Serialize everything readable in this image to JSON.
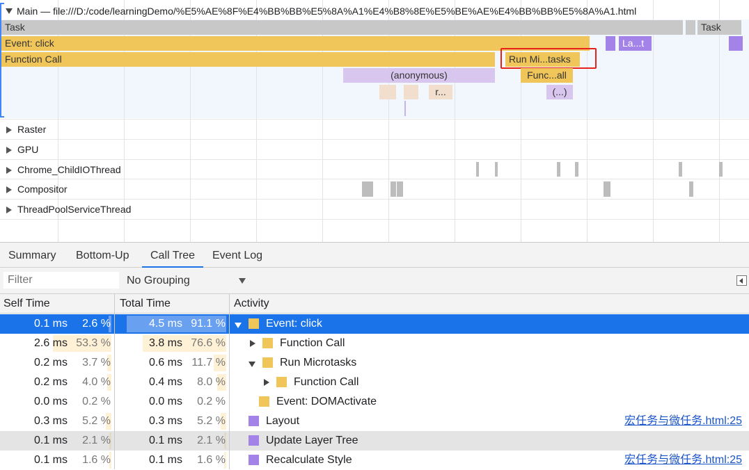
{
  "timeline": {
    "main_title": "Main — file:///D:/code/learningDemo/%E5%AE%8F%E4%BB%BB%E5%8A%A1%E4%B8%8E%E5%BE%AE%E4%BB%BB%E5%8A%A1.html",
    "bars": {
      "task1": "Task",
      "task2": "Task",
      "event_click": "Event: click",
      "layout_short": "La...t",
      "function_call": "Function Call",
      "run_microtasks": "Run Mi...tasks",
      "anonymous": "(anonymous)",
      "func_call_short": "Func...all",
      "r_short": "r...",
      "ellipsis": "(...)"
    },
    "tracks": [
      "Raster",
      "GPU",
      "Chrome_ChildIOThread",
      "Compositor",
      "ThreadPoolServiceThread"
    ]
  },
  "tabs": [
    {
      "label": "Summary",
      "active": false
    },
    {
      "label": "Bottom-Up",
      "active": false
    },
    {
      "label": "Call Tree",
      "active": true
    },
    {
      "label": "Event Log",
      "active": false
    }
  ],
  "filter": {
    "placeholder": "Filter",
    "grouping": "No Grouping"
  },
  "columns": {
    "self_time": "Self Time",
    "total_time": "Total Time",
    "activity": "Activity"
  },
  "rows": [
    {
      "self": "0.1 ms",
      "self_pct": "2.6 %",
      "total": "4.5 ms",
      "total_pct": "91.1 %",
      "activity": "Event: click",
      "link": "",
      "color": "#f0c65a",
      "expander": "down",
      "selected": true
    },
    {
      "self": "2.6 ms",
      "self_pct": "53.3 %",
      "total": "3.8 ms",
      "total_pct": "76.6 %",
      "activity": "Function Call",
      "link": "",
      "color": "#f0c65a",
      "expander": "right"
    },
    {
      "self": "0.2 ms",
      "self_pct": "3.7 %",
      "total": "0.6 ms",
      "total_pct": "11.7 %",
      "activity": "Run Microtasks",
      "link": "",
      "color": "#f0c65a",
      "expander": "down"
    },
    {
      "self": "0.2 ms",
      "self_pct": "4.0 %",
      "total": "0.4 ms",
      "total_pct": "8.0 %",
      "activity": "Function Call",
      "link": "",
      "color": "#f0c65a",
      "expander": "right"
    },
    {
      "self": "0.0 ms",
      "self_pct": "0.2 %",
      "total": "0.0 ms",
      "total_pct": "0.2 %",
      "activity": "Event: DOMActivate",
      "link": "",
      "color": "#f0c65a",
      "expander": "none"
    },
    {
      "self": "0.3 ms",
      "self_pct": "5.2 %",
      "total": "0.3 ms",
      "total_pct": "5.2 %",
      "activity": "Layout",
      "link": "宏任务与微任务.html:25",
      "color": "#a483e8",
      "expander": "none"
    },
    {
      "self": "0.1 ms",
      "self_pct": "2.1 %",
      "total": "0.1 ms",
      "total_pct": "2.1 %",
      "activity": "Update Layer Tree",
      "link": "",
      "color": "#a483e8",
      "expander": "none",
      "shaded": true
    },
    {
      "self": "0.1 ms",
      "self_pct": "1.6 %",
      "total": "0.1 ms",
      "total_pct": "1.6 %",
      "activity": "Recalculate Style",
      "link": "宏任务与微任务.html:25",
      "color": "#a483e8",
      "expander": "none"
    }
  ]
}
